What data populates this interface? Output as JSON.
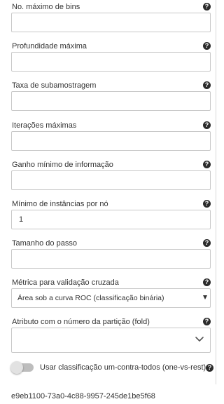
{
  "fields": [
    {
      "label": "No. máximo de bins",
      "value": ""
    },
    {
      "label": "Profundidade máxima",
      "value": ""
    },
    {
      "label": "Taxa de subamostragem",
      "value": ""
    },
    {
      "label": "Iterações máximas",
      "value": ""
    },
    {
      "label": "Ganho mínimo de informação",
      "value": ""
    },
    {
      "label": "Mínimo de instâncias por nó",
      "value": "1"
    },
    {
      "label": "Tamanho do passo",
      "value": ""
    }
  ],
  "metric": {
    "label": "Métrica para validação cruzada",
    "selected": "Área sob a curva ROC (classificação binária)"
  },
  "fold": {
    "label": "Atributo com o número da partição (fold)",
    "value": ""
  },
  "one_vs_rest": {
    "label": "Usar classificação um-contra-todos (one-vs-rest)",
    "enabled": false
  },
  "help_icon": "question-circle-icon",
  "footer": {
    "id": "e9eb1100-73a0-4c88-9957-245de1be5f68"
  }
}
